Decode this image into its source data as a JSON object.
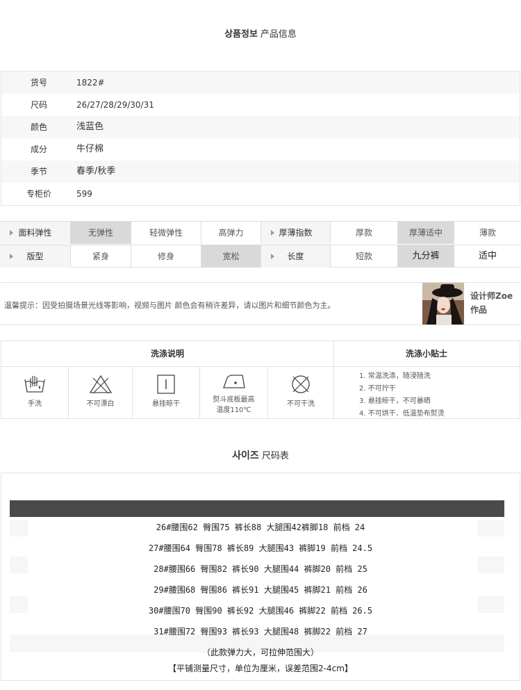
{
  "product_title": {
    "ko": "상품정보",
    "zh": "产品信息"
  },
  "info_rows": [
    {
      "label": "货号",
      "value": "1822#"
    },
    {
      "label": "尺码",
      "value": "26/27/28/29/30/31"
    },
    {
      "label": "颜色",
      "value": "浅蓝色"
    },
    {
      "label": "成分",
      "value": "牛仔棉"
    },
    {
      "label": "季节",
      "value": "春季/秋季"
    },
    {
      "label": "专柜价",
      "value": "599"
    }
  ],
  "attributes": {
    "row1": {
      "head1": "面料弹性",
      "opts1": [
        "无弹性",
        "轻微弹性",
        "高弹力"
      ],
      "head2": "厚薄指数",
      "opts2": [
        "厚款",
        "厚薄适中",
        "薄款"
      ]
    },
    "row2": {
      "head1": "版型",
      "opts1": [
        "紧身",
        "修身",
        "宽松"
      ],
      "head2": "长度",
      "opts2": [
        "短款",
        "九分裤",
        "适中"
      ]
    },
    "selected": {
      "elasticity": "无弹性",
      "thickness": "厚薄适中",
      "fit": "宽松",
      "length": "九分裤"
    }
  },
  "notice": {
    "text": "温馨提示：因受拍摄场景光线等影响，视频与图片  颜色会有稍许差异，请以图片和细节颜色为主。",
    "designer_line1": "设计师Zoe",
    "designer_line2": "作品"
  },
  "wash": {
    "header_left": "洗涤说明",
    "header_right": "洗涤小贴士",
    "icons": [
      {
        "icon": "hand-wash-icon",
        "label": "手洗"
      },
      {
        "icon": "no-bleach-icon",
        "label": "不可漂白"
      },
      {
        "icon": "hang-dry-icon",
        "label": "悬挂晾干"
      },
      {
        "icon": "iron-icon",
        "label1": "熨斗底板最高",
        "label2": "温度110℃"
      },
      {
        "icon": "no-dry-clean-icon",
        "label": "不可干洗"
      }
    ],
    "tips": [
      "1. 常温洗涤，随浸随洗",
      "2. 不可拧干",
      "3. 悬挂晾干，不可暴晒",
      "4. 不可烘干、低温垫布熨烫"
    ]
  },
  "size_title": {
    "ko": "사이즈",
    "zh": "尺码表"
  },
  "size_rows": [
    "26#腰围62 臀围75 裤长88 大腿围42裤脚18 前档 24",
    "27#腰围64 臀围78 裤长89 大腿围43 裤脚19 前档 24.5",
    "28#腰围66 臀围82 裤长90 大腿围44 裤脚20 前档 25",
    "29#腰围68 臀围86 裤长91  大腿围45 裤脚21 前档 26",
    "30#腰围70 臀围90 裤长92 大腿围46  裤脚22 前档 26.5",
    "31#腰围72 臀围93 裤长93 大腿围48  裤脚22 前档 27"
  ],
  "size_notes": [
    "（此款弹力大，可拉伸范围大）",
    "【平铺测量尺寸，单位为厘米，误差范围2-4cm】"
  ]
}
